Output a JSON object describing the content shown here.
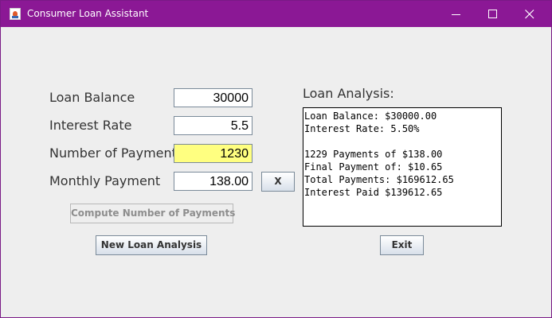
{
  "window": {
    "title": "Consumer Loan Assistant",
    "icon": "java-cup-icon",
    "controls": [
      "minimize-icon",
      "maximize-icon",
      "close-icon"
    ],
    "titlebar_color": "#8b1895"
  },
  "form": {
    "loan_balance_label": "Loan Balance",
    "loan_balance_value": "30000",
    "interest_rate_label": "Interest Rate",
    "interest_rate_value": "5.5",
    "num_payments_label": "Number of Payments",
    "num_payments_value": "1230",
    "monthly_payment_label": "Monthly Payment",
    "monthly_payment_value": "138.00",
    "highlight_color": "#ffff80"
  },
  "buttons": {
    "toggle_label": "X",
    "compute_label": "Compute Number of Payments",
    "new_analysis_label": "New Loan Analysis",
    "exit_label": "Exit"
  },
  "analysis": {
    "heading": "Loan Analysis:",
    "lines": [
      "Loan Balance: $30000.00",
      "Interest Rate: 5.50%",
      "",
      "1229 Payments of $138.00",
      "Final Payment of: $10.65",
      "Total Payments: $169612.65",
      "Interest Paid $139612.65"
    ]
  }
}
